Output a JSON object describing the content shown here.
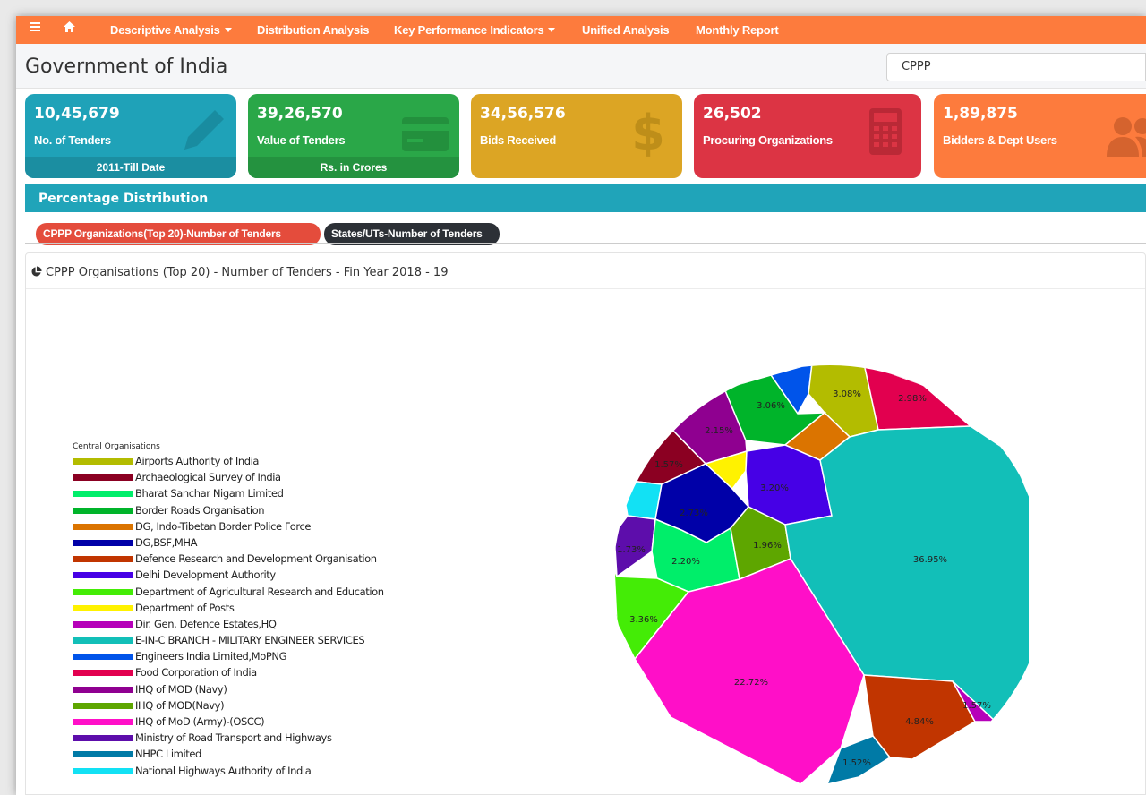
{
  "nav": {
    "menu_icon": "hamburger-icon",
    "home_icon": "home-icon",
    "items": [
      {
        "label": "Descriptive Analysis",
        "dropdown": true
      },
      {
        "label": "Distribution Analysis",
        "dropdown": false
      },
      {
        "label": "Key Performance Indicators",
        "dropdown": true
      },
      {
        "label": "Unified Analysis",
        "dropdown": false
      },
      {
        "label": "Monthly Report",
        "dropdown": false
      }
    ],
    "color": "#fd7b3d"
  },
  "header": {
    "title": "Government of India",
    "search_value": "CPPP"
  },
  "stats": [
    {
      "value": "10,45,679",
      "label": "No. of Tenders",
      "footer": "2011-Till Date",
      "color": "#1fa2b8",
      "footer_color": "#1b8ea1",
      "icon": "pencil-icon"
    },
    {
      "value": "39,26,570",
      "label": "Value of Tenders",
      "footer": "Rs. in Crores",
      "color": "#2aa748",
      "footer_color": "#24923f",
      "icon": "credit-card-icon"
    },
    {
      "value": "34,56,576",
      "label": "Bids Received",
      "footer": "",
      "color": "#dca524",
      "footer_color": "#dca524",
      "icon": "dollar-icon"
    },
    {
      "value": "26,502",
      "label": "Procuring Organizations",
      "footer": "",
      "color": "#dc3444",
      "footer_color": "#dc3444",
      "icon": "calculator-icon"
    },
    {
      "value": "1,89,875",
      "label": "Bidders & Dept Users",
      "footer": "",
      "color": "#fd7b3d",
      "footer_color": "#fd7b3d",
      "icon": "users-icon"
    }
  ],
  "section": {
    "title": "Percentage Distribution"
  },
  "tabs": [
    {
      "label": "CPPP Organizations(Top 20)-Number of Tenders",
      "active": true
    },
    {
      "label": "States/UTs-Number of Tenders",
      "active": false
    }
  ],
  "chart_data": {
    "type": "voronoi-treemap",
    "title": "CPPP Organisations (Top 20) - Number of Tenders - Fin Year 2018 - 19",
    "legend_title": "Central Organisations",
    "legend": [
      {
        "name": "Airports Authority of India",
        "color": "#b3bc00"
      },
      {
        "name": "Archaeological Survey of India",
        "color": "#8b0022"
      },
      {
        "name": "Bharat Sanchar Nigam Limited",
        "color": "#00ee6a"
      },
      {
        "name": "Border Roads Organisation",
        "color": "#00b42a"
      },
      {
        "name": "DG, Indo-Tibetan Border Police Force",
        "color": "#db7400"
      },
      {
        "name": "DG,BSF,MHA",
        "color": "#0000a8"
      },
      {
        "name": "Defence Research and Development Organisation",
        "color": "#c13500"
      },
      {
        "name": "Delhi Development Authority",
        "color": "#4600e6"
      },
      {
        "name": "Department of Agricultural Research and Education",
        "color": "#44ec06"
      },
      {
        "name": "Department of Posts",
        "color": "#fff200"
      },
      {
        "name": "Dir. Gen. Defence Estates,HQ",
        "color": "#b600b9"
      },
      {
        "name": "E-IN-C BRANCH - MILITARY ENGINEER SERVICES",
        "color": "#12bfb8"
      },
      {
        "name": "Engineers India Limited,MoPNG",
        "color": "#0054ea"
      },
      {
        "name": "Food Corporation of India",
        "color": "#e2004f"
      },
      {
        "name": "IHQ of MOD (Navy)",
        "color": "#8f0090"
      },
      {
        "name": "IHQ of MOD(Navy)",
        "color": "#5ea600"
      },
      {
        "name": "IHQ of MoD (Army)-(OSCC)",
        "color": "#ff0fc8"
      },
      {
        "name": "Ministry of Road Transport and Highways",
        "color": "#5d0dab"
      },
      {
        "name": "NHPC Limited",
        "color": "#007aa6"
      },
      {
        "name": "National Highways Authority of India",
        "color": "#12e1f4"
      }
    ],
    "labels": [
      "3.06%",
      "3.08%",
      "2.98%",
      "2.15%",
      "1.57%",
      "3.20%",
      "2.73%",
      "1.96%",
      "1.73%",
      "2.20%",
      "36.95%",
      "3.36%",
      "22.72%",
      "1.57%",
      "4.84%",
      "1.52%"
    ],
    "cells": [
      {
        "color": "#0054ea",
        "label": ""
      },
      {
        "color": "#b3bc00",
        "label": "3.08%"
      },
      {
        "color": "#e2004f",
        "label": "2.98%"
      },
      {
        "color": "#00b42a",
        "label": "3.06%"
      },
      {
        "color": "#8f0090",
        "label": "2.15%"
      },
      {
        "color": "#8b0022",
        "label": "1.57%"
      },
      {
        "color": "#fff200",
        "label": ""
      },
      {
        "color": "#db7400",
        "label": ""
      },
      {
        "color": "#4600e6",
        "label": "3.20%"
      },
      {
        "color": "#12e1f4",
        "label": ""
      },
      {
        "color": "#0000a8",
        "label": "2.73%"
      },
      {
        "color": "#5d0dab",
        "label": "1.73%"
      },
      {
        "color": "#00ee6a",
        "label": "2.20%"
      },
      {
        "color": "#5ea600",
        "label": "1.96%"
      },
      {
        "color": "#12bfb8",
        "label": "36.95%"
      },
      {
        "color": "#44ec06",
        "label": "3.36%"
      },
      {
        "color": "#ff0fc8",
        "label": "22.72%"
      },
      {
        "color": "#c13500",
        "label": "4.84%"
      },
      {
        "color": "#b600b9",
        "label": "1.57%"
      },
      {
        "color": "#007aa6",
        "label": "1.52%"
      }
    ]
  }
}
